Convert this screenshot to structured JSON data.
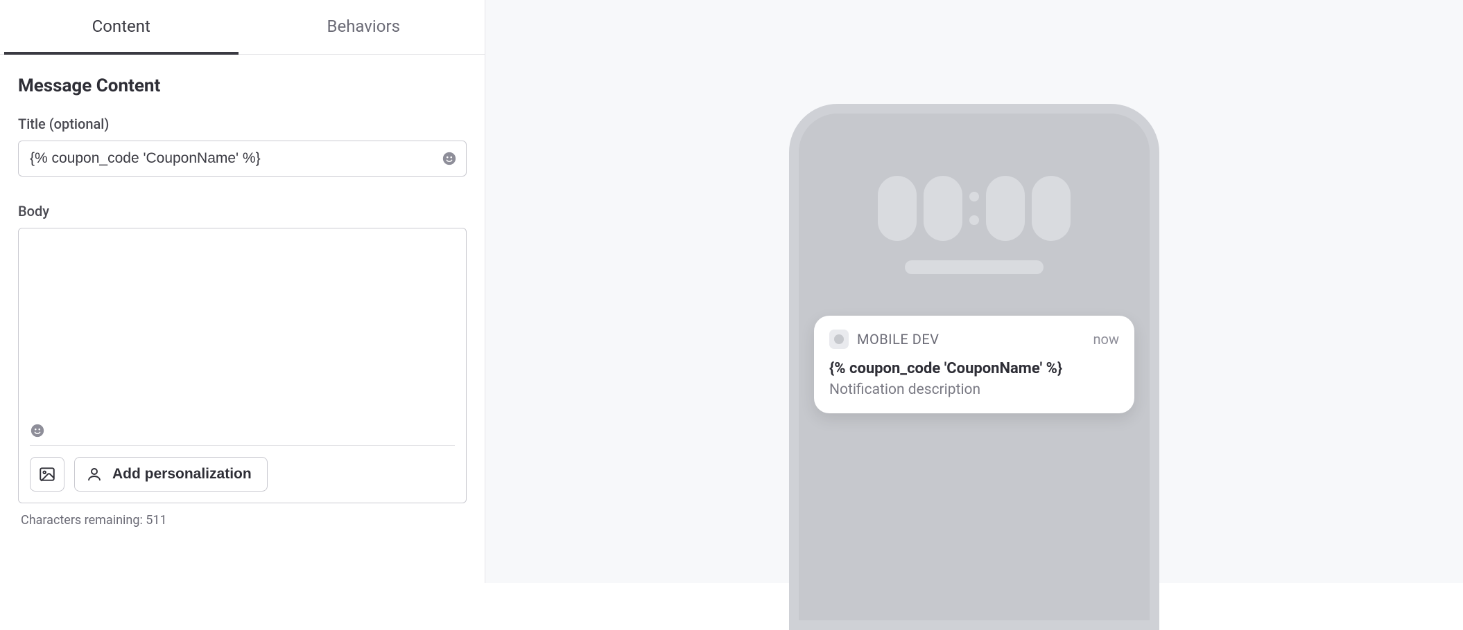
{
  "tabs": {
    "content": "Content",
    "behaviors": "Behaviors"
  },
  "section_title": "Message Content",
  "title": {
    "label": "Title (optional)",
    "value": "{% coupon_code 'CouponName' %}"
  },
  "body": {
    "label": "Body",
    "value": "",
    "add_personalization_label": "Add personalization",
    "chars_remaining_text": "Characters remaining: 511"
  },
  "preview": {
    "app_name": "MOBILE DEV",
    "time": "now",
    "notif_title": "{% coupon_code 'CouponName' %}",
    "notif_desc": "Notification description"
  }
}
